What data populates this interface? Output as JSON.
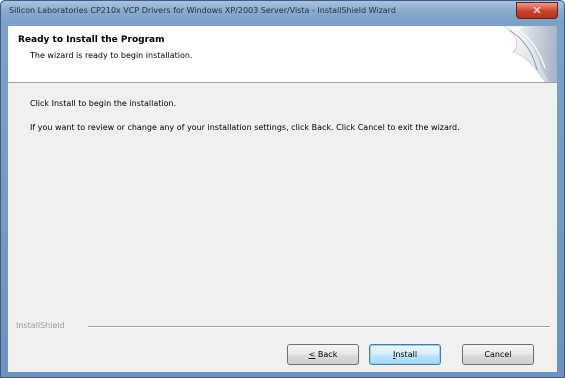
{
  "window": {
    "title": "Silicon Laboratories CP210x VCP Drivers for Windows XP/2003 Server/Vista - InstallShield Wizard",
    "close_glyph": "✕"
  },
  "header": {
    "title": "Ready to Install the Program",
    "subtitle": "The wizard is ready to begin installation."
  },
  "body": {
    "instruction": "Click Install to begin the installation.",
    "detail": "If you want to review or change any of your installation settings, click Back. Click Cancel to exit the wizard."
  },
  "footer": {
    "brand": "InstallShield",
    "buttons": {
      "back": "< Back",
      "install": "Install",
      "cancel": "Cancel"
    }
  },
  "colors": {
    "titlebar": "#8aabcf",
    "close_button": "#c7442a",
    "dialog_background": "#f0f0f0",
    "header_background": "#ffffff",
    "default_button_border": "#3c7fb1"
  }
}
